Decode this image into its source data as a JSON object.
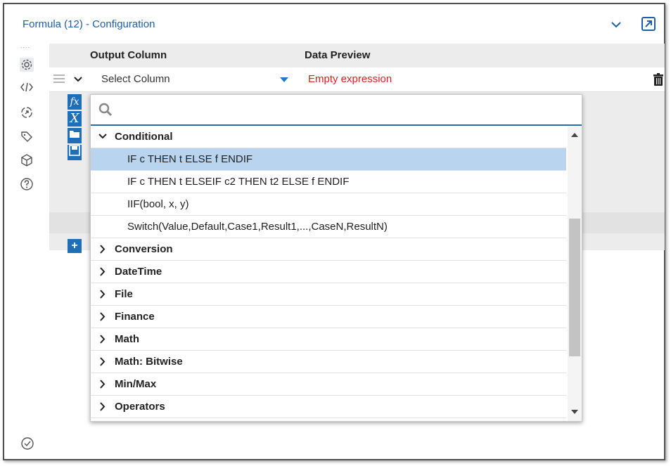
{
  "window": {
    "title": "Formula (12) - Configuration"
  },
  "sidebar": {
    "icons": [
      "settings-gear-icon",
      "code-icon",
      "navigate-icon",
      "tag-icon",
      "cube-icon",
      "help-icon"
    ],
    "status_icon": "check-circle-icon"
  },
  "grid": {
    "headers": {
      "output": "Output Column",
      "preview": "Data Preview"
    },
    "row": {
      "select_value": "Select Column",
      "preview_value": "Empty expression"
    },
    "toolbar": {
      "function_label": "fx",
      "variable_label": "X"
    },
    "colors": {
      "accent": "#1e6fb8",
      "error": "#e0201d",
      "selected": "#b8d4ef"
    }
  },
  "popup": {
    "search_placeholder": "",
    "categories": [
      {
        "label": "Conditional",
        "expanded": true,
        "functions": [
          "IF c THEN t ELSE f ENDIF",
          "IF c THEN t ELSEIF c2 THEN t2 ELSE f ENDIF",
          "IIF(bool, x, y)",
          "Switch(Value,Default,Case1,Result1,...,CaseN,ResultN)"
        ]
      },
      {
        "label": "Conversion",
        "expanded": false
      },
      {
        "label": "DateTime",
        "expanded": false
      },
      {
        "label": "File",
        "expanded": false
      },
      {
        "label": "Finance",
        "expanded": false
      },
      {
        "label": "Math",
        "expanded": false
      },
      {
        "label": "Math: Bitwise",
        "expanded": false
      },
      {
        "label": "Min/Max",
        "expanded": false
      },
      {
        "label": "Operators",
        "expanded": false
      }
    ],
    "selected_function": "IF c THEN t ELSE f ENDIF"
  }
}
